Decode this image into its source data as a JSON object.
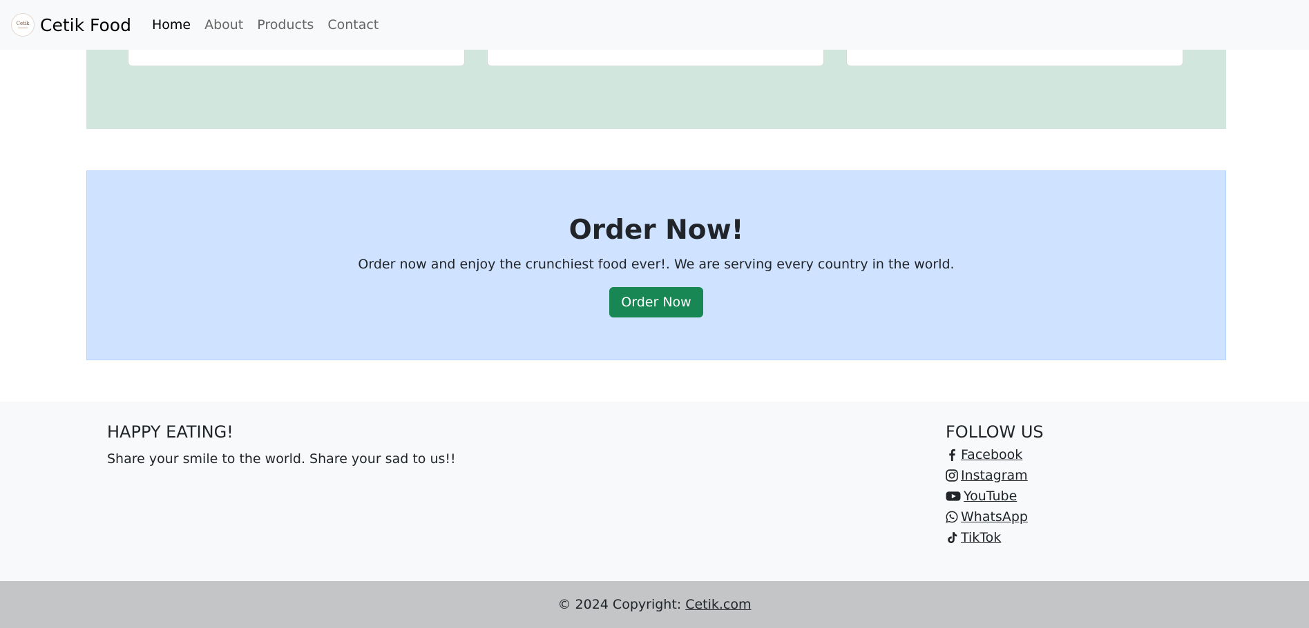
{
  "navbar": {
    "logo_text": "Cetik",
    "brand": "Cetik Food",
    "links": [
      {
        "label": "Home",
        "active": true
      },
      {
        "label": "About",
        "active": false
      },
      {
        "label": "Products",
        "active": false
      },
      {
        "label": "Contact",
        "active": false
      }
    ]
  },
  "order": {
    "title": "Order Now!",
    "text": "Order now and enjoy the crunchiest food ever!. We are serving every country in the world.",
    "button_label": "Order Now",
    "button_color": "#198754",
    "background_color": "#cfe2ff"
  },
  "products_section": {
    "background_color": "#d1e7dd"
  },
  "footer": {
    "heading": "HAPPY EATING!",
    "tagline": "Share your smile to the world. Share your sad to us!!",
    "follow_heading": "FOLLOW US",
    "social": [
      {
        "label": " Facebook",
        "icon": "facebook-icon"
      },
      {
        "label": " Instagram",
        "icon": "instagram-icon"
      },
      {
        "label": " YouTube",
        "icon": "youtube-icon"
      },
      {
        "label": " WhatsApp",
        "icon": "whatsapp-icon"
      },
      {
        "label": " TikTok",
        "icon": "tiktok-icon"
      }
    ]
  },
  "copyright": {
    "text": "© 2024 Copyright:",
    "link_label": "Cetik.com"
  }
}
